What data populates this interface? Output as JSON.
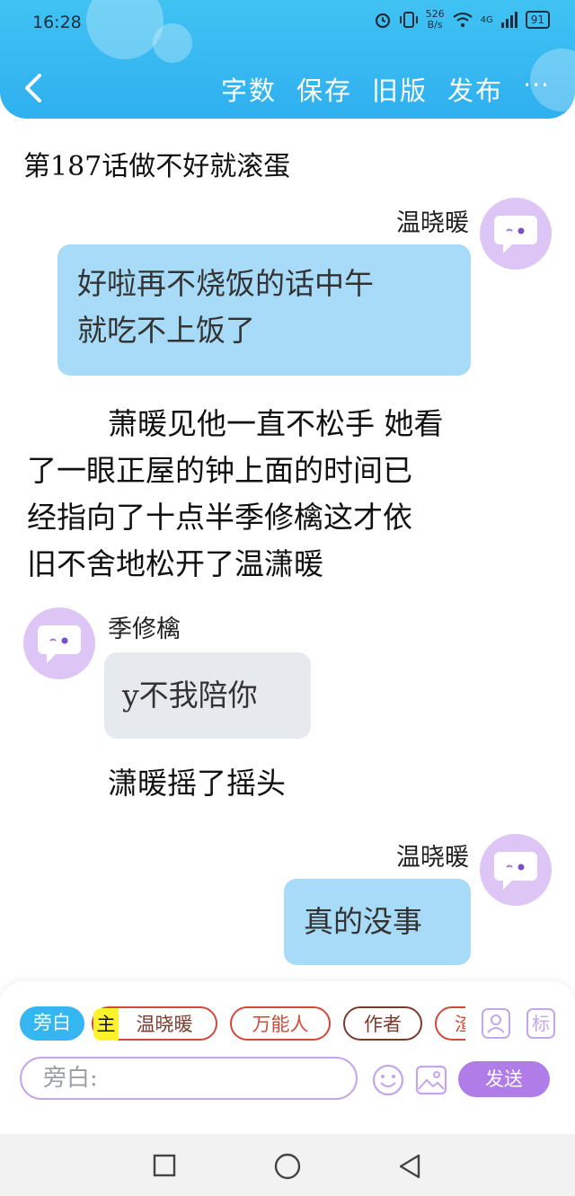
{
  "status_bar": {
    "time": "16:28",
    "net_speed_value": "526",
    "net_speed_unit": "B/s",
    "network": "4G",
    "battery": "91"
  },
  "toolbar": {
    "actions": [
      "字数",
      "保存",
      "旧版",
      "发布"
    ],
    "more": "···"
  },
  "chapter_title": "第187话做不好就滚蛋",
  "messages": [
    {
      "type": "bubble",
      "side": "right",
      "speaker": "温晓暖",
      "lines": [
        "好啦再不烧饭的话中午",
        "就吃不上饭了"
      ],
      "color": "#a8dbf7"
    },
    {
      "type": "narration",
      "lines": [
        "萧暖见他一直不松手 她看",
        "了一眼正屋的钟上面的时间已",
        "经指向了十点半季修檎这才依",
        "旧不舍地松开了温潇暖"
      ]
    },
    {
      "type": "bubble",
      "side": "left",
      "speaker": "季修檎",
      "lines": [
        "y不我陪你"
      ],
      "color": "#e6e9ee"
    },
    {
      "type": "narration",
      "lines": [
        "潇暖摇了摇头"
      ]
    },
    {
      "type": "bubble",
      "side": "right",
      "speaker": "温晓暖",
      "lines": [
        "真的没事"
      ],
      "color": "#a8dbf7"
    }
  ],
  "editor": {
    "roles": [
      {
        "label": "旁白",
        "style": "active"
      },
      {
        "label": "温晓暖",
        "prefix": "主",
        "style": "outline",
        "color": "#d3483a"
      },
      {
        "label": "万能人",
        "style": "outline",
        "color": "#d3483a"
      },
      {
        "label": "作者",
        "style": "outline",
        "color": "#7a3b2e"
      },
      {
        "label": "渣男",
        "style": "outline",
        "color": "#d3483a"
      }
    ],
    "role_manage_icon": "person-card-icon",
    "mark_label": "标",
    "input_placeholder": "旁白:",
    "emoji_icon": "smiley-icon",
    "image_icon": "image-icon",
    "send_label": "发送"
  },
  "nav_bar": {
    "icons": [
      "recent-apps-icon",
      "home-icon",
      "back-icon"
    ]
  },
  "colors": {
    "header": "#36b6f1",
    "accent_purple": "#b07de8",
    "avatar_bg": "#ddc6f6"
  }
}
